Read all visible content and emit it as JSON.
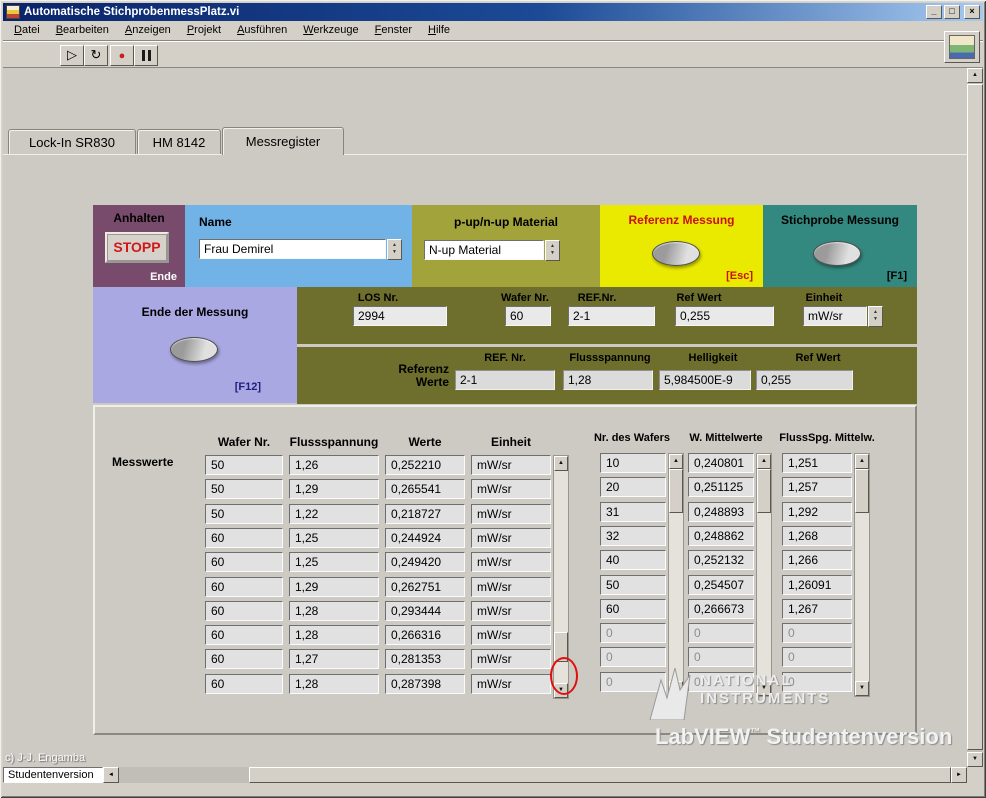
{
  "window": {
    "title": "Automatische StichprobenmessPlatz.vi"
  },
  "icons": {
    "run": "▷",
    "run_continuous": "↻",
    "abort": "●",
    "minimize": "_",
    "maximize": "□",
    "close": "×",
    "arrow_up": "▲",
    "arrow_down": "▼",
    "arrow_left": "◄",
    "arrow_right": "►"
  },
  "menu": {
    "items": [
      "Datei",
      "Bearbeiten",
      "Anzeigen",
      "Projekt",
      "Ausführen",
      "Werkzeuge",
      "Fenster",
      "Hilfe"
    ]
  },
  "tabs": [
    {
      "label": "Lock-In SR830",
      "active": false
    },
    {
      "label": "HM 8142",
      "active": false
    },
    {
      "label": "Messregister",
      "active": true
    }
  ],
  "panels": {
    "anhalten": {
      "title": "Anhalten",
      "stop_label": "STOPP",
      "hotkey": "Ende"
    },
    "name": {
      "title": "Name",
      "value": "Frau Demirel"
    },
    "material": {
      "title": "p-up/n-up Material",
      "value": "N-up Material"
    },
    "referenz_messung": {
      "title": "Referenz Messung",
      "hotkey": "[Esc]"
    },
    "stichprobe_messung": {
      "title": "Stichprobe Messung",
      "hotkey": "[F1]"
    },
    "ende_der_messung": {
      "title": "Ende der Messung",
      "hotkey": "[F12]"
    }
  },
  "fields": {
    "los_nr": {
      "label": "LOS Nr.",
      "value": "2994"
    },
    "wafer_nr": {
      "label": "Wafer Nr.",
      "value": "60"
    },
    "ref_nr": {
      "label": "REF.Nr.",
      "value": "2-1"
    },
    "ref_wert": {
      "label": "Ref Wert",
      "value": "0,255"
    },
    "einheit": {
      "label": "Einheit",
      "value": "mW/sr"
    }
  },
  "referenz_werte": {
    "label": "Referenz Werte",
    "headers": [
      "REF. Nr.",
      "Flussspannung",
      "Helligkeit",
      "Ref Wert"
    ],
    "values": [
      "2-1",
      "1,28",
      "5,984500E-9",
      "0,255"
    ]
  },
  "messwerte": {
    "label": "Messwerte",
    "headers": [
      "Wafer Nr.",
      "Flussspannung",
      "Werte",
      "Einheit"
    ],
    "rows": [
      [
        "50",
        "1,26",
        "0,252210",
        "mW/sr"
      ],
      [
        "50",
        "1,29",
        "0,265541",
        "mW/sr"
      ],
      [
        "50",
        "1,22",
        "0,218727",
        "mW/sr"
      ],
      [
        "60",
        "1,25",
        "0,244924",
        "mW/sr"
      ],
      [
        "60",
        "1,25",
        "0,249420",
        "mW/sr"
      ],
      [
        "60",
        "1,29",
        "0,262751",
        "mW/sr"
      ],
      [
        "60",
        "1,28",
        "0,293444",
        "mW/sr"
      ],
      [
        "60",
        "1,28",
        "0,266316",
        "mW/sr"
      ],
      [
        "60",
        "1,27",
        "0,281353",
        "mW/sr"
      ],
      [
        "60",
        "1,28",
        "0,287398",
        "mW/sr"
      ]
    ]
  },
  "mittelwerte": {
    "headers": [
      "Nr. des Wafers",
      "W. Mittelwerte",
      "FlussSpg. Mittelw."
    ],
    "columns": [
      [
        "10",
        "20",
        "31",
        "32",
        "40",
        "50",
        "60",
        "0",
        "0",
        "0"
      ],
      [
        "0,240801",
        "0,251125",
        "0,248893",
        "0,248862",
        "0,252132",
        "0,254507",
        "0,266673",
        "0",
        "0",
        "0"
      ],
      [
        "1,251",
        "1,257",
        "1,292",
        "1,268",
        "1,266",
        "1,26091",
        "1,267",
        "0",
        "0",
        "0"
      ]
    ]
  },
  "branding": {
    "ni_line1": "NATIONAL",
    "ni_line2": "INSTRUMENTS",
    "labview": "LabVIEW",
    "tm": "™",
    "edition": "Studentenversion"
  },
  "footer": {
    "credit": "c) J-J. Engamba",
    "status_box": "Studentenversion"
  }
}
